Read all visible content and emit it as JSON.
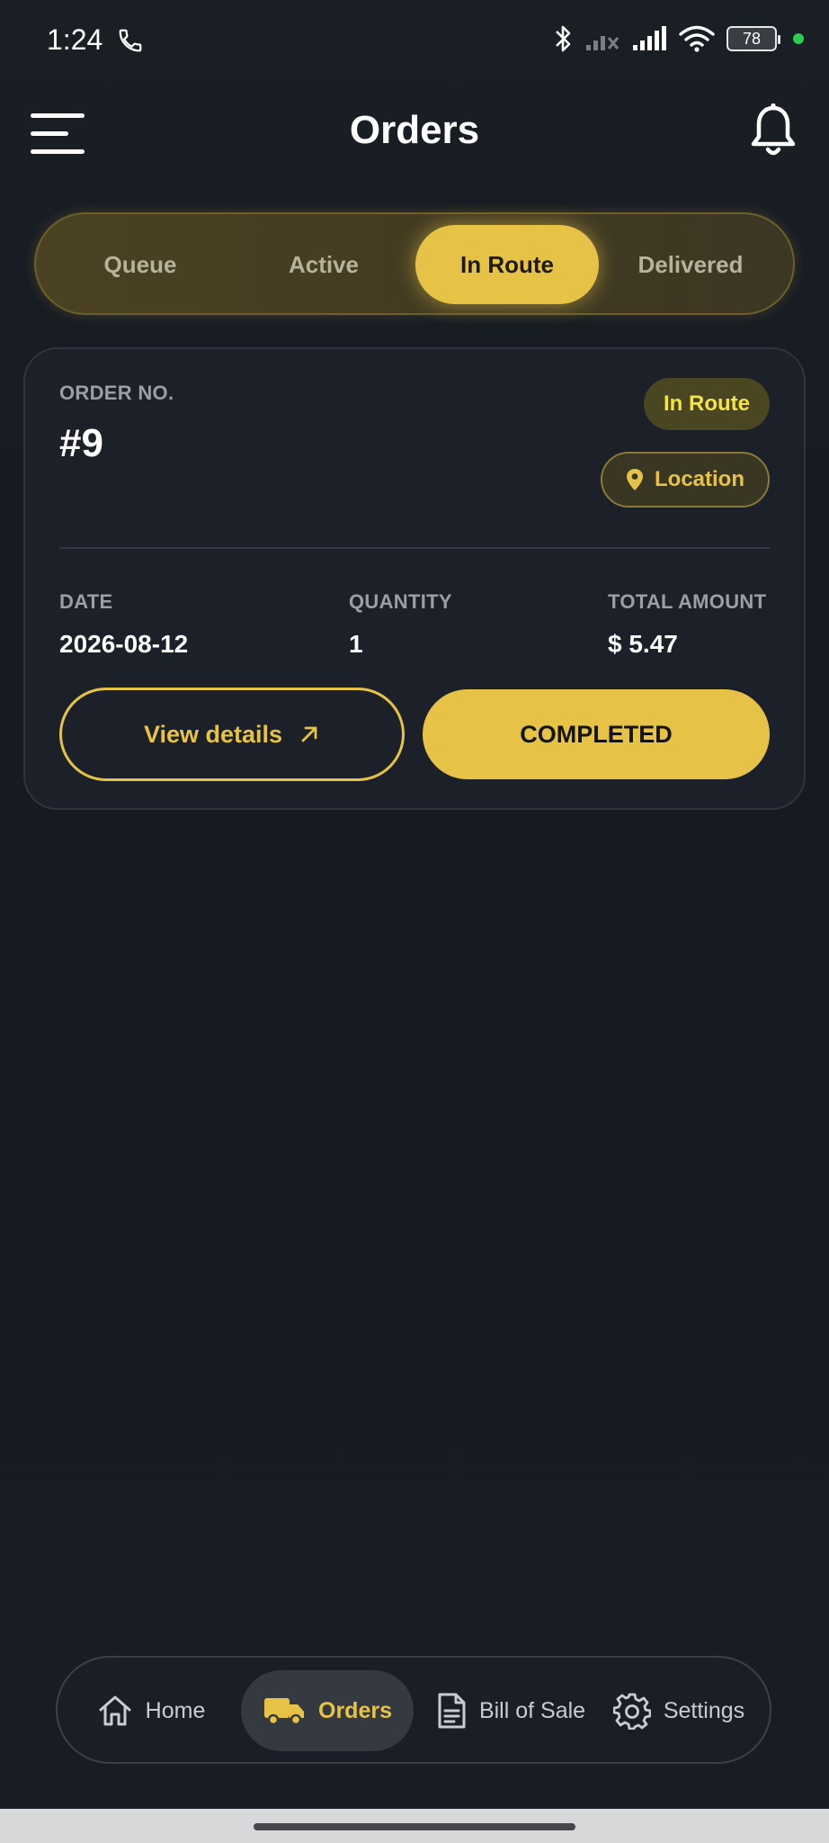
{
  "status_bar": {
    "time": "1:24",
    "battery": "78",
    "icons": [
      "phone-icon",
      "bluetooth-icon",
      "signal-off-icon",
      "signal-icon",
      "wifi-icon",
      "battery-icon"
    ]
  },
  "header": {
    "title": "Orders"
  },
  "tabs": [
    {
      "label": "Queue",
      "active": false
    },
    {
      "label": "Active",
      "active": false
    },
    {
      "label": "In Route",
      "active": true
    },
    {
      "label": "Delivered",
      "active": false
    }
  ],
  "order": {
    "order_no_label": "ORDER NO.",
    "order_no": "#9",
    "status": "In Route",
    "location_label": "Location",
    "date_label": "DATE",
    "date": "2026-08-12",
    "quantity_label": "QUANTITY",
    "quantity": "1",
    "total_label": "TOTAL AMOUNT",
    "total": "$ 5.47",
    "view_details_label": "View details",
    "completed_label": "COMPLETED"
  },
  "bottom_nav": [
    {
      "label": "Home",
      "icon": "home-icon",
      "active": false
    },
    {
      "label": "Orders",
      "icon": "truck-icon",
      "active": true
    },
    {
      "label": "Bill of Sale",
      "icon": "document-icon",
      "active": false
    },
    {
      "label": "Settings",
      "icon": "gear-icon",
      "active": false
    }
  ],
  "colors": {
    "accent": "#e6c347",
    "background": "#171b22",
    "card": "#1b2029",
    "status_text": "#f2e34a"
  }
}
